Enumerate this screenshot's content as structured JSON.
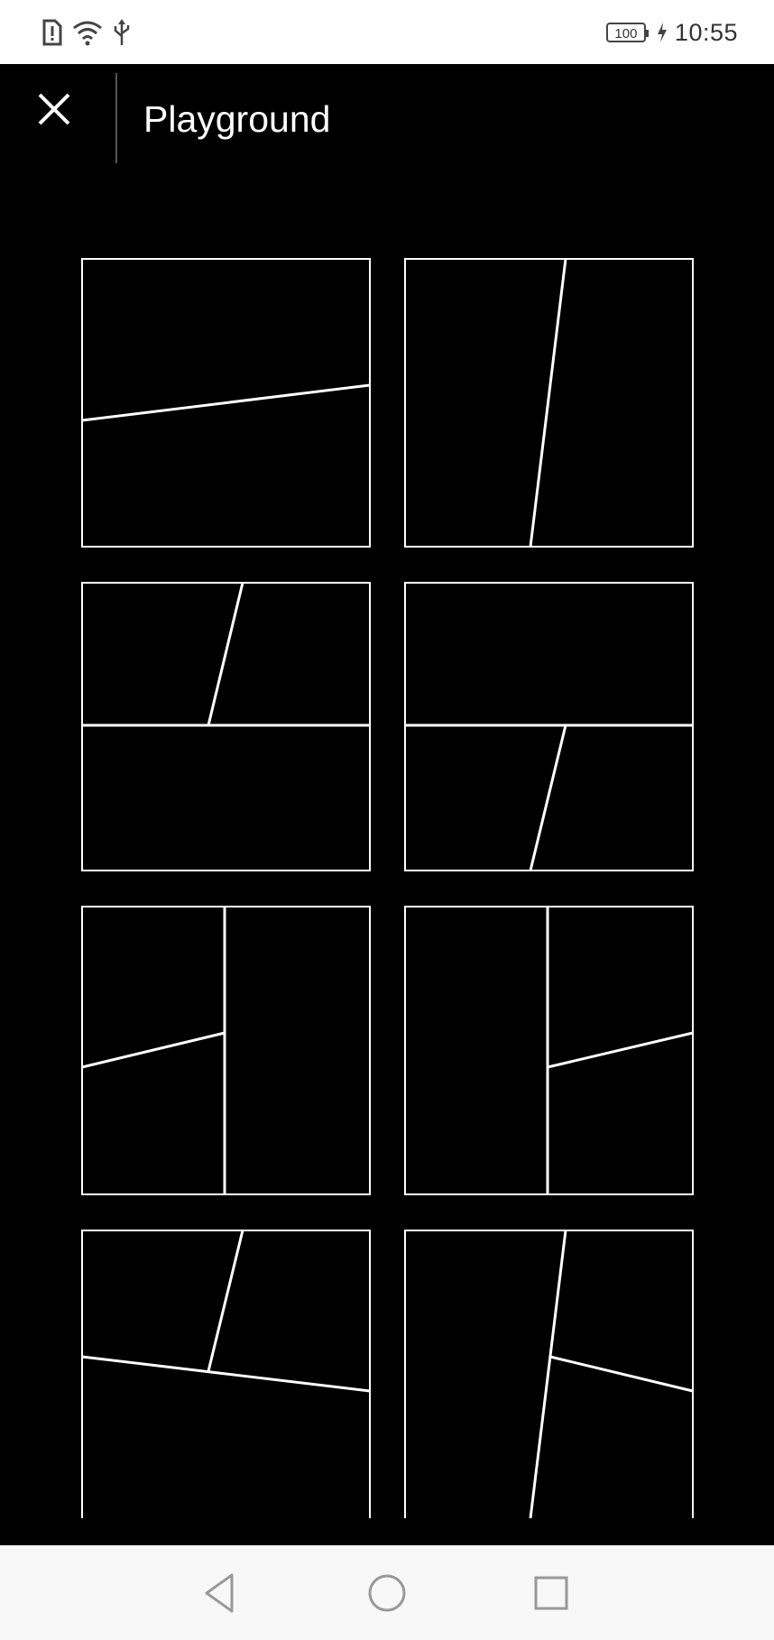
{
  "status_bar": {
    "time": "10:55",
    "battery": "100",
    "icons": [
      "sim-alert-icon",
      "wifi-icon",
      "usb-icon",
      "battery-icon",
      "charging-icon"
    ]
  },
  "toolbar": {
    "title": "Playground",
    "close_icon": "close-icon"
  },
  "layouts": [
    {
      "name": "layout-1",
      "tile_color": "#ffffff"
    },
    {
      "name": "layout-2",
      "tile_color": "#ffffff"
    },
    {
      "name": "layout-3",
      "tile_color": "#ffffff"
    },
    {
      "name": "layout-4",
      "tile_color": "#ffffff"
    },
    {
      "name": "layout-5",
      "tile_color": "#ffffff"
    },
    {
      "name": "layout-6",
      "tile_color": "#ffffff"
    },
    {
      "name": "layout-7",
      "tile_color": "#ffffff"
    },
    {
      "name": "layout-8",
      "tile_color": "#ffffff"
    }
  ],
  "nav_bar": {
    "icons": [
      "back-icon",
      "home-icon",
      "recents-icon"
    ]
  },
  "colors": {
    "background": "#000000",
    "stroke": "#ffffff",
    "status_bar": "#ffffff",
    "nav_bar": "#f8f8f8"
  }
}
